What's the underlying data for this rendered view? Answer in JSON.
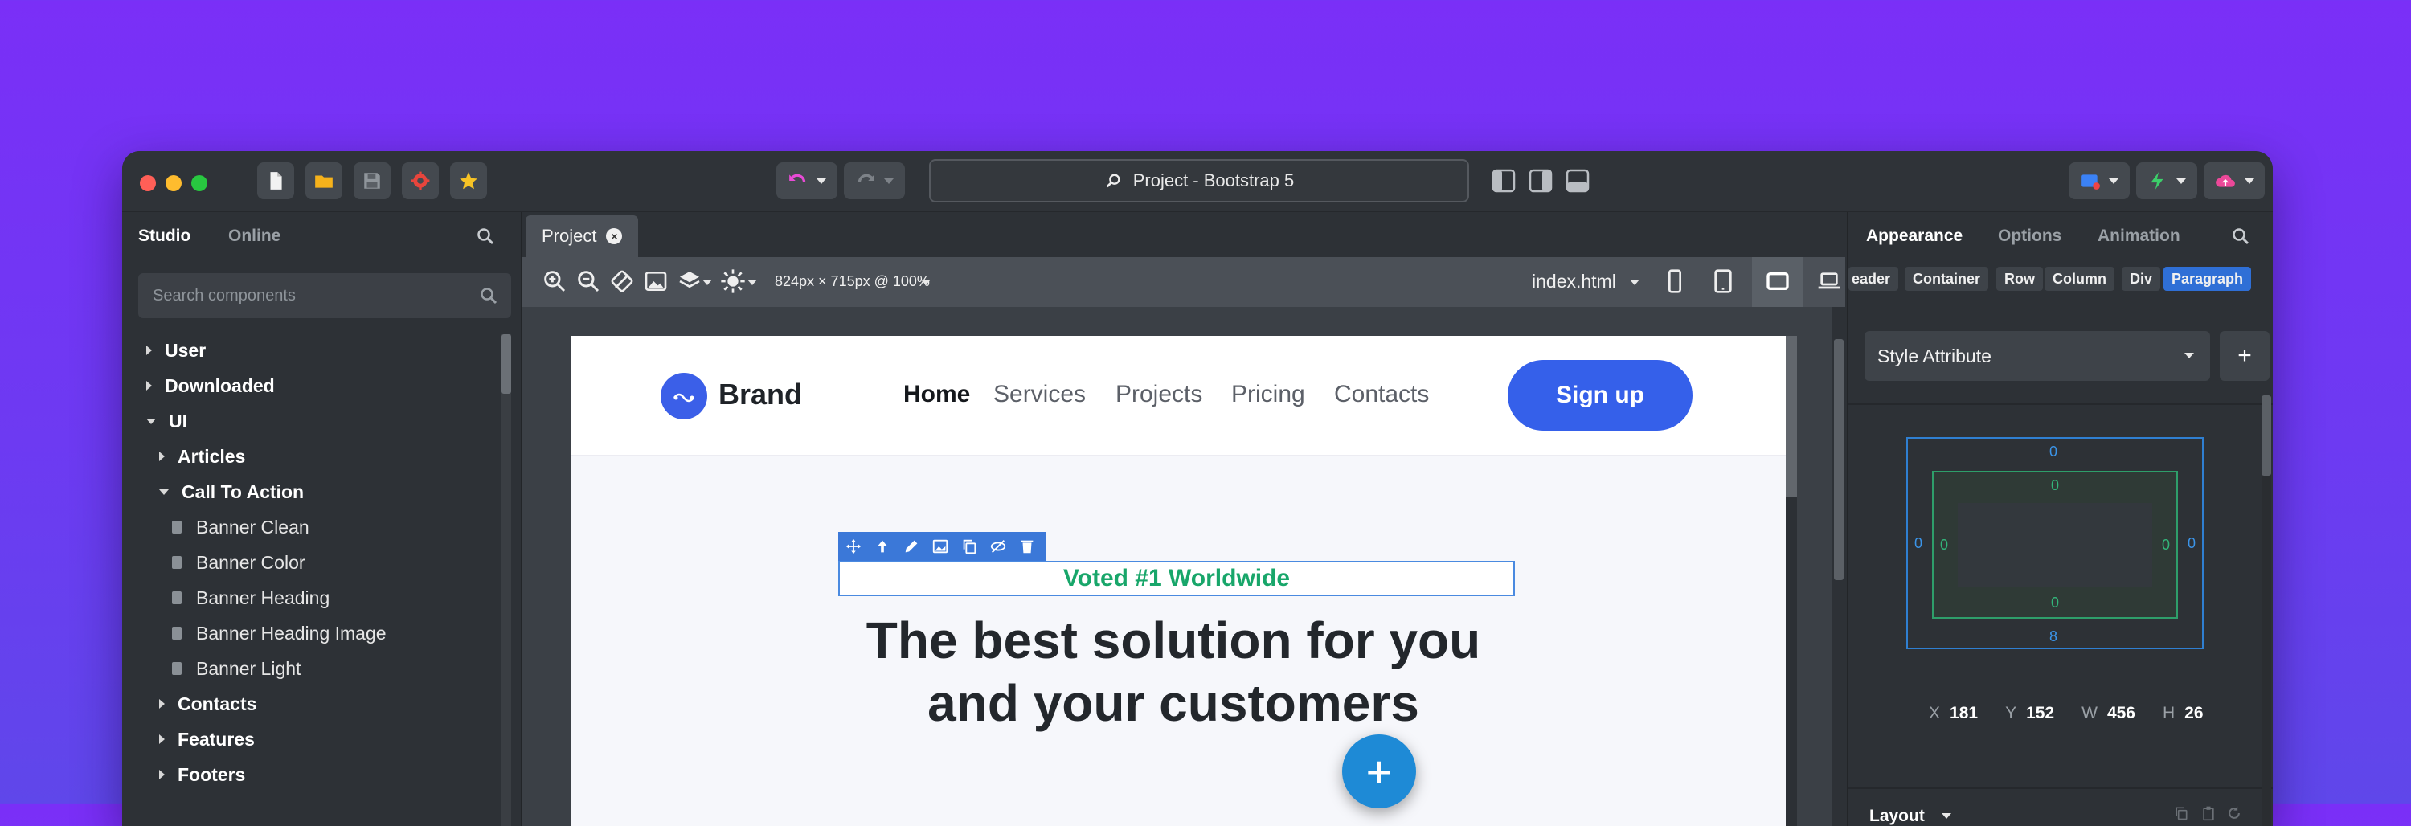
{
  "window": {
    "search_title": "Project - Bootstrap 5",
    "colors": {
      "close": "#ff5f57",
      "minimize": "#febc2e",
      "maximize": "#28c840",
      "accent": "#3560ea"
    }
  },
  "left_panel": {
    "tabs": [
      {
        "label": "Studio",
        "active": true
      },
      {
        "label": "Online",
        "active": false
      }
    ],
    "search_placeholder": "Search components",
    "tree": [
      {
        "label": "User",
        "type": "folder",
        "expanded": false
      },
      {
        "label": "Downloaded",
        "type": "folder",
        "expanded": false
      },
      {
        "label": "UI",
        "type": "folder",
        "expanded": true
      },
      {
        "label": "Articles",
        "type": "folder",
        "expanded": false
      },
      {
        "label": "Call To Action",
        "type": "folder",
        "expanded": true
      },
      {
        "label": "Banner Clean",
        "type": "leaf"
      },
      {
        "label": "Banner Color",
        "type": "leaf"
      },
      {
        "label": "Banner Heading",
        "type": "leaf"
      },
      {
        "label": "Banner Heading Image",
        "type": "leaf"
      },
      {
        "label": "Banner Light",
        "type": "leaf"
      },
      {
        "label": "Contacts",
        "type": "folder",
        "expanded": false
      },
      {
        "label": "Features",
        "type": "folder",
        "expanded": false
      },
      {
        "label": "Footers",
        "type": "folder",
        "expanded": false
      }
    ]
  },
  "center": {
    "doc_tab": "Project",
    "viewport_info": "824px × 715px @ 100%",
    "file_select": "index.html"
  },
  "preview": {
    "brand": "Brand",
    "nav": [
      {
        "label": "Home",
        "active": true
      },
      {
        "label": "Services",
        "active": false
      },
      {
        "label": "Projects",
        "active": false
      },
      {
        "label": "Pricing",
        "active": false
      },
      {
        "label": "Contacts",
        "active": false
      }
    ],
    "signup": "Sign up",
    "badge": "Voted #1 Worldwide",
    "headline_line1": "The best solution for you",
    "headline_line2": "and your customers",
    "fab": "+"
  },
  "right_panel": {
    "tabs": [
      {
        "label": "Appearance",
        "active": true
      },
      {
        "label": "Options",
        "active": false
      },
      {
        "label": "Animation",
        "active": false
      }
    ],
    "breadcrumbs": [
      "eader",
      "Container",
      "Row",
      "Column",
      "Div",
      "Paragraph"
    ],
    "style_select": "Style Attribute",
    "add_label": "+",
    "box_model": {
      "margin_top": "0",
      "margin_bottom": "8",
      "margin_left": "0",
      "margin_right": "0",
      "padding_top": "0",
      "padding_bottom": "0",
      "padding_left": "0",
      "padding_right": "0"
    },
    "coords": {
      "x_label": "X",
      "x": "181",
      "y_label": "Y",
      "y": "152",
      "w_label": "W",
      "w": "456",
      "h_label": "H",
      "h": "26"
    },
    "layout_label": "Layout"
  }
}
